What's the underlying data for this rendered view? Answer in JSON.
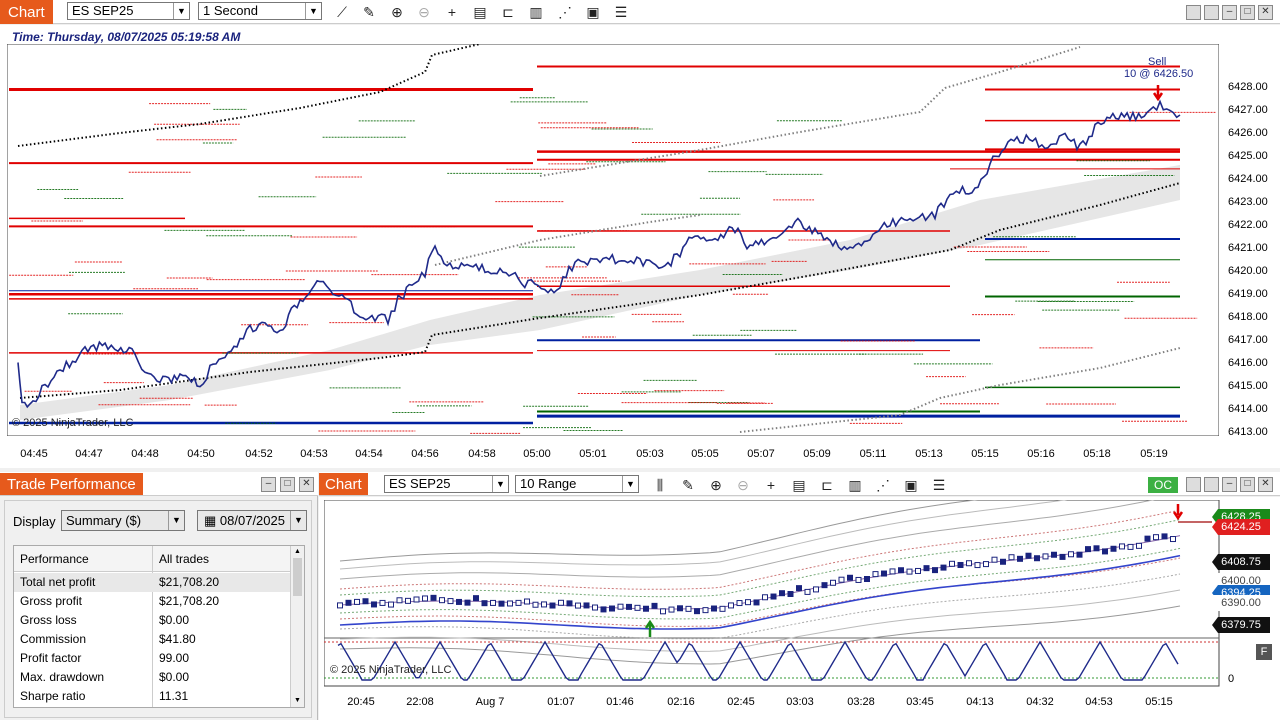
{
  "top_chart": {
    "tab": "Chart",
    "instrument": "ES SEP25",
    "interval": "1 Second",
    "time_label": "Time: Thursday, 08/07/2025 05:19:58 AM",
    "copyright": "© 2025 NinjaTrader, LLC",
    "sell_label": "Sell",
    "sell_detail": "10 @ 6426.50",
    "y_labels": [
      "6428.00",
      "6427.00",
      "6426.00",
      "6425.00",
      "6424.00",
      "6423.00",
      "6422.00",
      "6421.00",
      "6420.00",
      "6419.00",
      "6418.00",
      "6417.00",
      "6416.00",
      "6415.00",
      "6414.00",
      "6413.00"
    ],
    "x_labels": [
      "04:45",
      "04:47",
      "04:48",
      "04:50",
      "04:52",
      "04:53",
      "04:54",
      "04:56",
      "04:58",
      "05:00",
      "05:01",
      "05:03",
      "05:05",
      "05:07",
      "05:09",
      "05:11",
      "05:13",
      "05:15",
      "05:16",
      "05:18",
      "05:19"
    ],
    "colors": {
      "price": "#1f2a8a",
      "resistance": "#e00000",
      "support_blue": "#0020a0",
      "support_green": "#006400",
      "vwap": "#000000",
      "band": "#808080"
    }
  },
  "trade_performance": {
    "tab": "Trade Performance",
    "display_label": "Display",
    "display_value": "Summary ($)",
    "date_value": "08/07/2025",
    "col_performance": "Performance",
    "col_all_trades": "All trades",
    "rows": [
      {
        "label": "Total net profit",
        "value": "$21,708.20"
      },
      {
        "label": "Gross profit",
        "value": "$21,708.20"
      },
      {
        "label": "Gross loss",
        "value": "$0.00"
      },
      {
        "label": "Commission",
        "value": "$41.80"
      },
      {
        "label": "Profit factor",
        "value": "99.00"
      },
      {
        "label": "Max. drawdown",
        "value": "$0.00"
      },
      {
        "label": "Sharpe ratio",
        "value": "11.31"
      }
    ]
  },
  "bottom_chart": {
    "tab": "Chart",
    "instrument": "ES SEP25",
    "interval": "10 Range",
    "oc_label": "OC",
    "copyright": "© 2025 NinjaTrader, LLC",
    "price_tags": [
      {
        "text": "6428.25",
        "color": "#1a8a1a"
      },
      {
        "text": "6424.25",
        "color": "#e02020"
      },
      {
        "text": "6408.75",
        "color": "#111111"
      },
      {
        "text": "6400.00",
        "color": "#ffffff"
      },
      {
        "text": "6394.25",
        "color": "#1565c0"
      },
      {
        "text": "6390.00",
        "color": "#ffffff"
      },
      {
        "text": "6379.75",
        "color": "#111111"
      }
    ],
    "osc_zero": "0",
    "f_button": "F",
    "x_labels": [
      "20:45",
      "22:08",
      "Aug 7",
      "01:07",
      "01:46",
      "02:16",
      "02:45",
      "03:03",
      "03:28",
      "03:45",
      "04:13",
      "04:32",
      "04:53",
      "05:15"
    ]
  }
}
